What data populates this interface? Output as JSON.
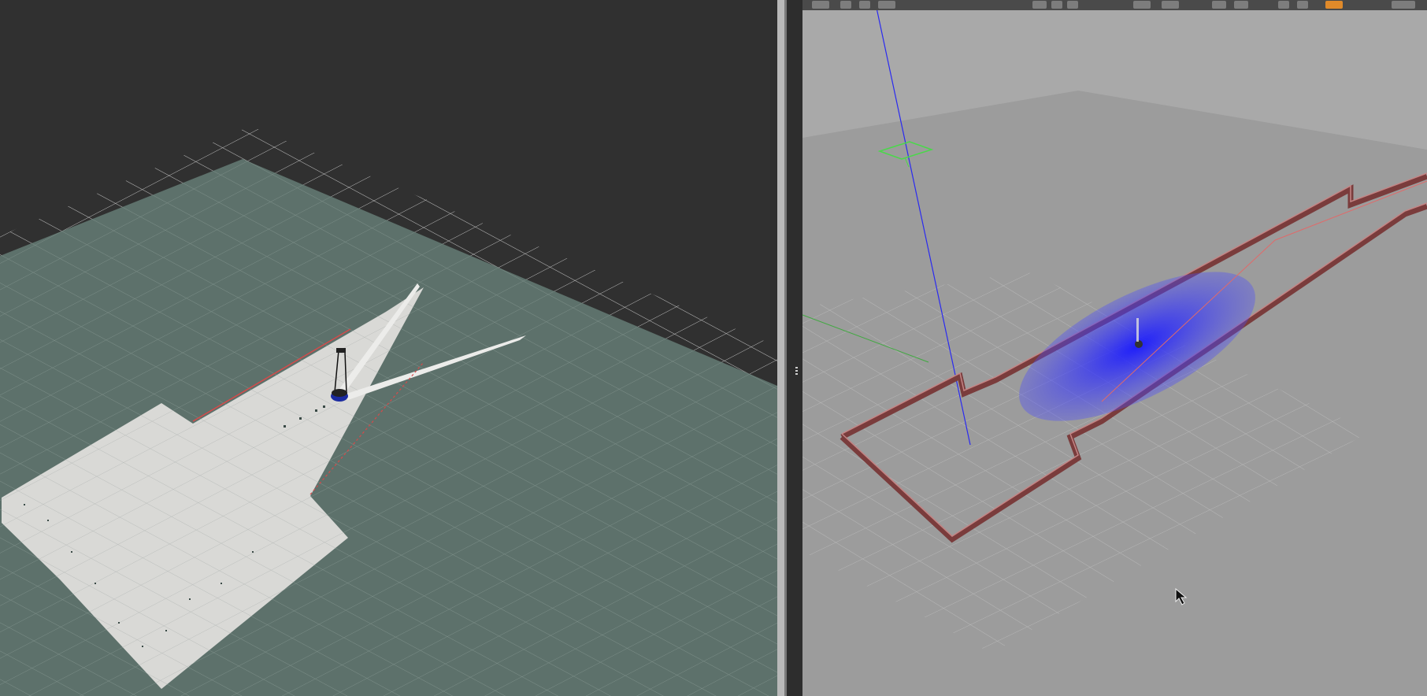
{
  "window": {
    "layout": "split",
    "left_pane": "rviz-3d-view",
    "right_pane": "gazebo-3d-view"
  },
  "rviz": {
    "background_color": "#303030",
    "map_unknown_color": "#5d716b",
    "map_free_color": "#d9d9d6",
    "grid_color": "#111111",
    "wall_color": "#d64a4a",
    "robot_color": "#1a2aa0"
  },
  "gazebo": {
    "sky_color": "#a8a8a8",
    "ground_color": "#9c9c9c",
    "wall_color": "#7a3c3c",
    "laser_color": "#2a2af0",
    "toolbar": {
      "icons": [
        "select-icon",
        "translate-icon",
        "rotate-icon",
        "scale-icon",
        "undo-icon",
        "redo-icon",
        "box-icon",
        "sphere-icon",
        "cylinder-icon",
        "pointlight-icon",
        "spotlight-icon",
        "dirlight-icon",
        "copy-icon",
        "paste-icon",
        "align-icon",
        "snap-icon",
        "view-angle-icon",
        "screenshot-icon",
        "log-icon"
      ]
    }
  }
}
